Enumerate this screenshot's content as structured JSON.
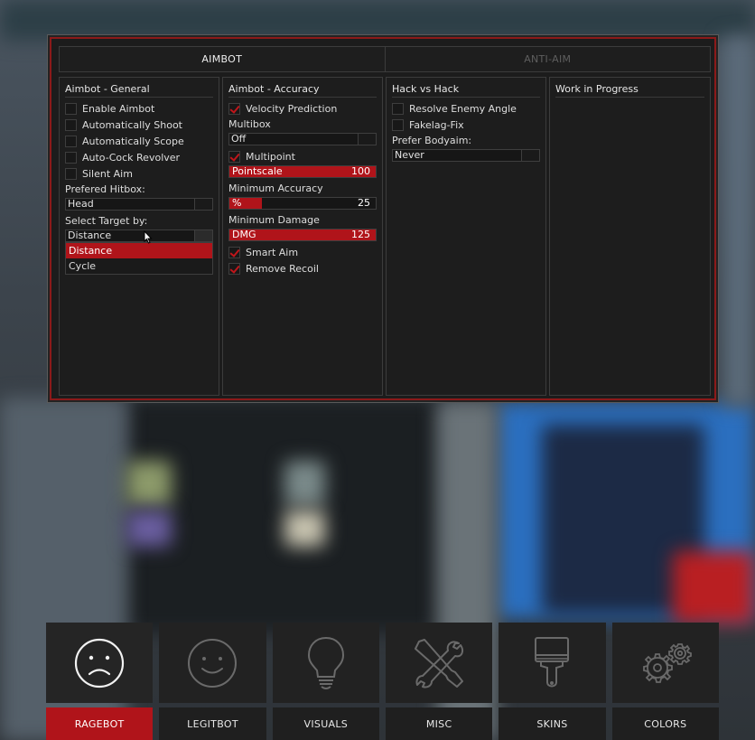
{
  "top_tabs": [
    {
      "label": "AIMBOT",
      "active": true
    },
    {
      "label": "ANTI-AIM",
      "active": false
    }
  ],
  "general": {
    "title": "Aimbot - General",
    "checkboxes": [
      {
        "label": "Enable Aimbot",
        "checked": false
      },
      {
        "label": "Automatically Shoot",
        "checked": false
      },
      {
        "label": "Automatically Scope",
        "checked": false
      },
      {
        "label": "Auto-Cock Revolver",
        "checked": false
      },
      {
        "label": "Silent Aim",
        "checked": false
      }
    ],
    "hitbox_label": "Prefered Hitbox:",
    "hitbox_value": "Head",
    "target_label": "Select Target by:",
    "target_value": "Distance",
    "target_options": [
      {
        "label": "Distance",
        "selected": true
      },
      {
        "label": "Cycle",
        "selected": false
      }
    ]
  },
  "accuracy": {
    "title": "Aimbot - Accuracy",
    "velocity_prediction": {
      "label": "Velocity Prediction",
      "checked": true
    },
    "multibox_label": "Multibox",
    "multibox_value": "Off",
    "multipoint": {
      "label": "Multipoint",
      "checked": true
    },
    "pointscale": {
      "label": "Pointscale",
      "value": "100",
      "fraction": 1.0
    },
    "min_accuracy_label": "Minimum Accuracy",
    "min_accuracy": {
      "label": "%",
      "value": "25",
      "fraction": 0.22
    },
    "min_damage_label": "Minimum Damage",
    "min_damage": {
      "label": "DMG",
      "value": "125",
      "fraction": 1.0
    },
    "smart_aim": {
      "label": "Smart Aim",
      "checked": true
    },
    "remove_recoil": {
      "label": "Remove Recoil",
      "checked": true
    }
  },
  "hvh": {
    "title": "Hack vs Hack",
    "resolve": {
      "label": "Resolve Enemy Angle",
      "checked": false
    },
    "fakelag_fix": {
      "label": "Fakelag-Fix",
      "checked": false
    },
    "bodyaim_label": "Prefer Bodyaim:",
    "bodyaim_value": "Never"
  },
  "wip": {
    "title": "Work in Progress"
  },
  "bottom_nav": [
    {
      "label": "RAGEBOT",
      "icon": "sad-face-icon",
      "active": true
    },
    {
      "label": "LEGITBOT",
      "icon": "smiley-face-icon",
      "active": false
    },
    {
      "label": "VISUALS",
      "icon": "lightbulb-icon",
      "active": false
    },
    {
      "label": "MISC",
      "icon": "tools-icon",
      "active": false
    },
    {
      "label": "SKINS",
      "icon": "paintbrush-icon",
      "active": false
    },
    {
      "label": "COLORS",
      "icon": "gears-icon",
      "active": false
    }
  ],
  "colors": {
    "accent": "#b0141a",
    "border": "#8b1a1a",
    "panel_bg": "#1d1d1d"
  }
}
